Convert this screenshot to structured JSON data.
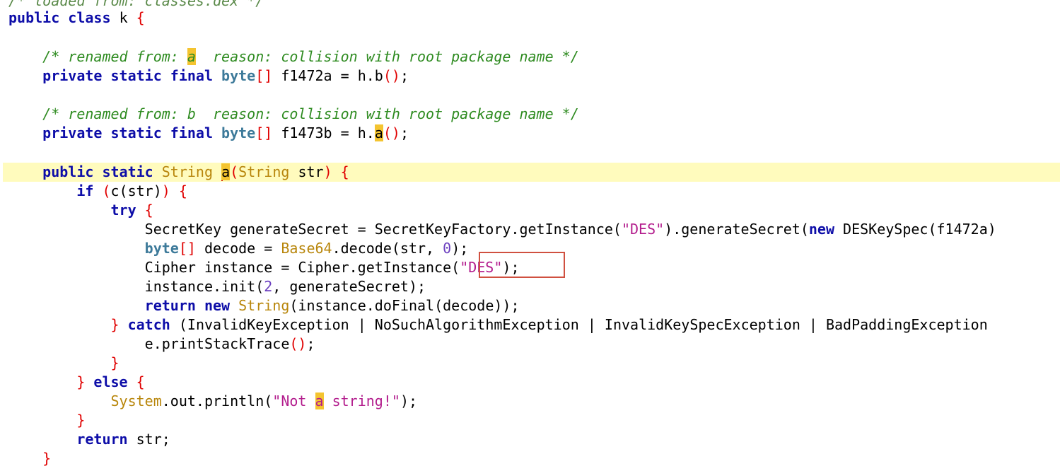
{
  "code": {
    "top_comment": "/* loaded from: classes.dex */",
    "class_public": "public",
    "class_kw": "class",
    "class_name": "k",
    "comment1_pre": "/* renamed from: ",
    "comment1_name": "a",
    "comment1_post": "  reason: collision with root package name */",
    "field_mods": "private static final",
    "byte_kw": "byte",
    "field1_decl": " f1472a = h.b",
    "comment2": "/* renamed from: b  reason: collision with root package name */",
    "field2_decl_pre": " f1473b = h.",
    "field2_method": "a",
    "method_mods": "public static",
    "string_type": "String",
    "method_name": "a",
    "method_param_type": "String",
    "method_param": " str",
    "if_kw": "if",
    "if_cond": "c(str)",
    "try_kw": "try",
    "line_secret_pre": "SecretKey generateSecret = SecretKeyFactory.getInstance(",
    "des_str": "\"DES\"",
    "line_secret_mid": ").generateSecret(",
    "new_kw": "new",
    "line_secret_post": " DESKeySpec(",
    "line_secret_tail": "f1472a)",
    "decode_rest": " decode = ",
    "base64": "Base64",
    "decode_call": ".decode(str, ",
    "decode_zero": "0",
    "decode_end": ");",
    "cipher_pre": "Cipher instance = Cipher.getInstance",
    "cipher_str": "\"DES\"",
    "cipher_end": ");",
    "init_pre": "instance.init(",
    "init_num": "2",
    "init_post": ", generateSecret);",
    "return_kw": "return",
    "return_rest": "(instance.doFinal(decode));",
    "catch_kw": "catch",
    "catch_rest": "(InvalidKeyException | NoSuchAlgorithmException | InvalidKeySpecException | BadPaddingException",
    "print_trace": "e.printStackTrace",
    "else_kw": "else",
    "system": "System",
    "println_pre": ".out.println(",
    "println_str_pre": "\"Not ",
    "println_str_a": "a",
    "println_str_post": " string!\"",
    "println_end": ");",
    "return_str": " str;"
  },
  "colors": {
    "keyword": "#0d0da8",
    "comment": "#2e8b20",
    "string": "#b31d8d",
    "bracket": "#e00000",
    "highlight": "#f4c430",
    "current_line": "#fffbbd",
    "annotation_box": "#d05040"
  }
}
